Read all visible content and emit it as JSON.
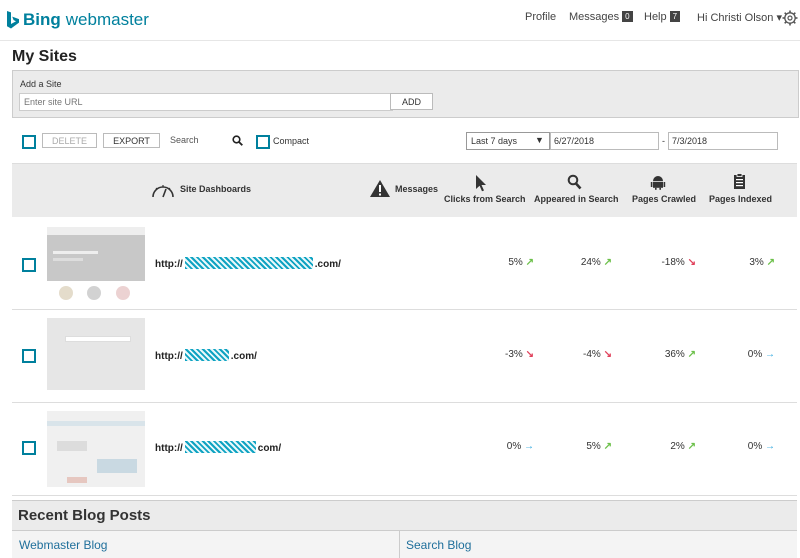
{
  "header": {
    "brand_bold": "Bing",
    "brand_sub": "webmaster",
    "profile": "Profile",
    "messages": "Messages",
    "messages_count": "0",
    "help": "Help",
    "help_count": "7",
    "user": "Hi Christi Olson ▾"
  },
  "page": {
    "title": "My Sites"
  },
  "add_site": {
    "label": "Add a Site",
    "placeholder": "Enter site URL",
    "button": "ADD"
  },
  "toolbar": {
    "delete": "DELETE",
    "export": "EXPORT",
    "search_placeholder": "Search",
    "compact": "Compact",
    "range": "Last 7 days",
    "date_from": "6/27/2018",
    "date_sep": "-",
    "date_to": "7/3/2018"
  },
  "columns": {
    "dashboards": "Site Dashboards",
    "messages": "Messages",
    "clicks": "Clicks from Search",
    "appeared": "Appeared in Search",
    "crawled": "Pages Crawled",
    "indexed": "Pages Indexed"
  },
  "sites": [
    {
      "prefix": "http://",
      "suffix": ".com/",
      "clicks": "5%",
      "clicks_trend": "up",
      "appeared": "24%",
      "appeared_trend": "up",
      "crawled": "-18%",
      "crawled_trend": "down",
      "indexed": "3%",
      "indexed_trend": "up"
    },
    {
      "prefix": "http://",
      "suffix": ".com/",
      "clicks": "-3%",
      "clicks_trend": "down",
      "appeared": "-4%",
      "appeared_trend": "down",
      "crawled": "36%",
      "crawled_trend": "up",
      "indexed": "0%",
      "indexed_trend": "flat"
    },
    {
      "prefix": "http://",
      "suffix": "com/",
      "clicks": "0%",
      "clicks_trend": "flat",
      "appeared": "5%",
      "appeared_trend": "up",
      "crawled": "2%",
      "crawled_trend": "up",
      "indexed": "0%",
      "indexed_trend": "flat"
    }
  ],
  "recent": {
    "title": "Recent Blog Posts",
    "blog1": "Webmaster Blog",
    "blog2": "Search Blog"
  },
  "colors": {
    "brand": "#00809d",
    "up": "#6cc04a",
    "down": "#e0405a",
    "flat": "#2ba6de"
  }
}
